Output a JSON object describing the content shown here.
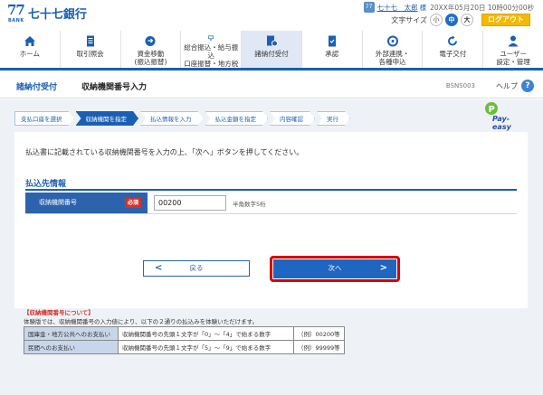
{
  "header": {
    "logo_mark": "77",
    "logo_bank": "BANK",
    "bank_name": "七十七銀行",
    "user_badge": "77",
    "user_name": "七十七　太郎",
    "user_honorific": "様",
    "last_login": "20XX年05月20日 10時00分00秒",
    "font_size_label": "文字サイズ",
    "font_sizes": [
      "小",
      "中",
      "大"
    ],
    "logout": "ログアウト"
  },
  "nav": {
    "items": [
      {
        "label": "ホーム",
        "icon": "home-icon"
      },
      {
        "label": "取引照会",
        "icon": "document-icon"
      },
      {
        "label": "資金移動\n(振込振替)",
        "icon": "transfer-icon"
      },
      {
        "label": "総合振込・給与振込\n口座振替・地方税",
        "icon": "monitor-icon"
      },
      {
        "label": "諸納付受付",
        "icon": "payment-icon"
      },
      {
        "label": "承認",
        "icon": "approval-icon"
      },
      {
        "label": "外部連携・\n各種申込",
        "icon": "link-icon"
      },
      {
        "label": "電子交付",
        "icon": "refresh-icon"
      },
      {
        "label": "ユーザー\n設定・管理",
        "icon": "user-icon"
      }
    ]
  },
  "title": {
    "category": "諸納付受付",
    "page": "収納機関番号入力",
    "screen_id": "BSNS003",
    "help": "ヘルプ",
    "help_icon": "?"
  },
  "steps": [
    "支払口座を選択",
    "収納機関を指定",
    "払込情報を入力",
    "払込金額を指定",
    "内容確認",
    "実行"
  ],
  "payeasy": {
    "label": "Pay-easy"
  },
  "form": {
    "instruction": "払込書に記載されている収納機関番号を入力の上、「次へ」ボタンを押してください。",
    "section_title": "払込先情報",
    "field_label": "収納機関番号",
    "required": "必須",
    "field_value": "00200",
    "hint": "半角数字5桁"
  },
  "buttons": {
    "back": "戻る",
    "back_chev": "<",
    "next": "次へ",
    "next_chev": ">"
  },
  "notes": {
    "title": "【収納機関番号について】",
    "text": "体験版では、収納機関番号の入力値により、以下の２通りの払込みを体験いただけます。",
    "rows": [
      {
        "head": "国庫金・地方公共へのお支払い",
        "desc": "収納機関番号の先頭１文字が「0」～「4」で始まる数字",
        "example": "（例）00200等"
      },
      {
        "head": "民間へのお支払い",
        "desc": "収納機関番号の先頭１文字が「5」～「9」で始まる数字",
        "example": "（例）99999等"
      }
    ]
  },
  "colors": {
    "primary": "#1a5fb4",
    "accent": "#f5b800",
    "required": "#d0342c",
    "highlight": "#d60000"
  }
}
